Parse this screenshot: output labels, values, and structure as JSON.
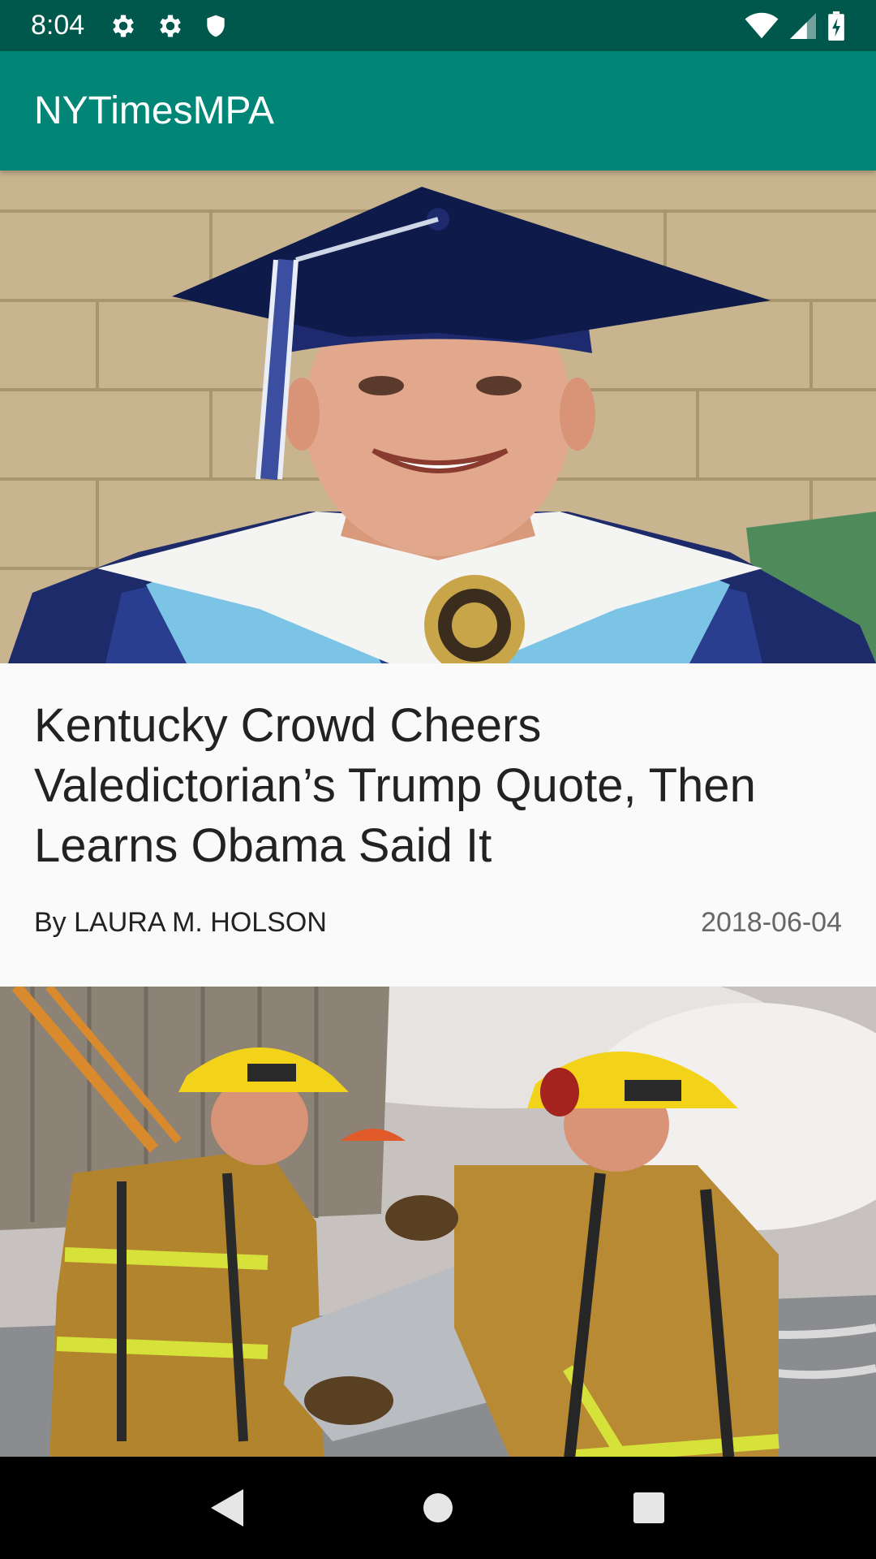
{
  "status_bar": {
    "time": "8:04",
    "left_icons": [
      "settings-icon",
      "settings-icon",
      "shield-icon"
    ],
    "right_icons": [
      "wifi-icon",
      "cell-signal-icon",
      "battery-charging-icon"
    ]
  },
  "app_bar": {
    "title": "NYTimesMPA",
    "color": "#008577",
    "status_color": "#00574b"
  },
  "articles": [
    {
      "image": "graduate-photo",
      "title": "Kentucky Crowd Cheers Valedictorian’s Trump Quote, Then Learns Obama Said It",
      "byline": "By LAURA M. HOLSON",
      "date": "2018-06-04"
    },
    {
      "image": "firefighters-photo"
    }
  ],
  "nav_bar": {
    "buttons": [
      "back-icon",
      "home-icon",
      "recents-icon"
    ]
  }
}
